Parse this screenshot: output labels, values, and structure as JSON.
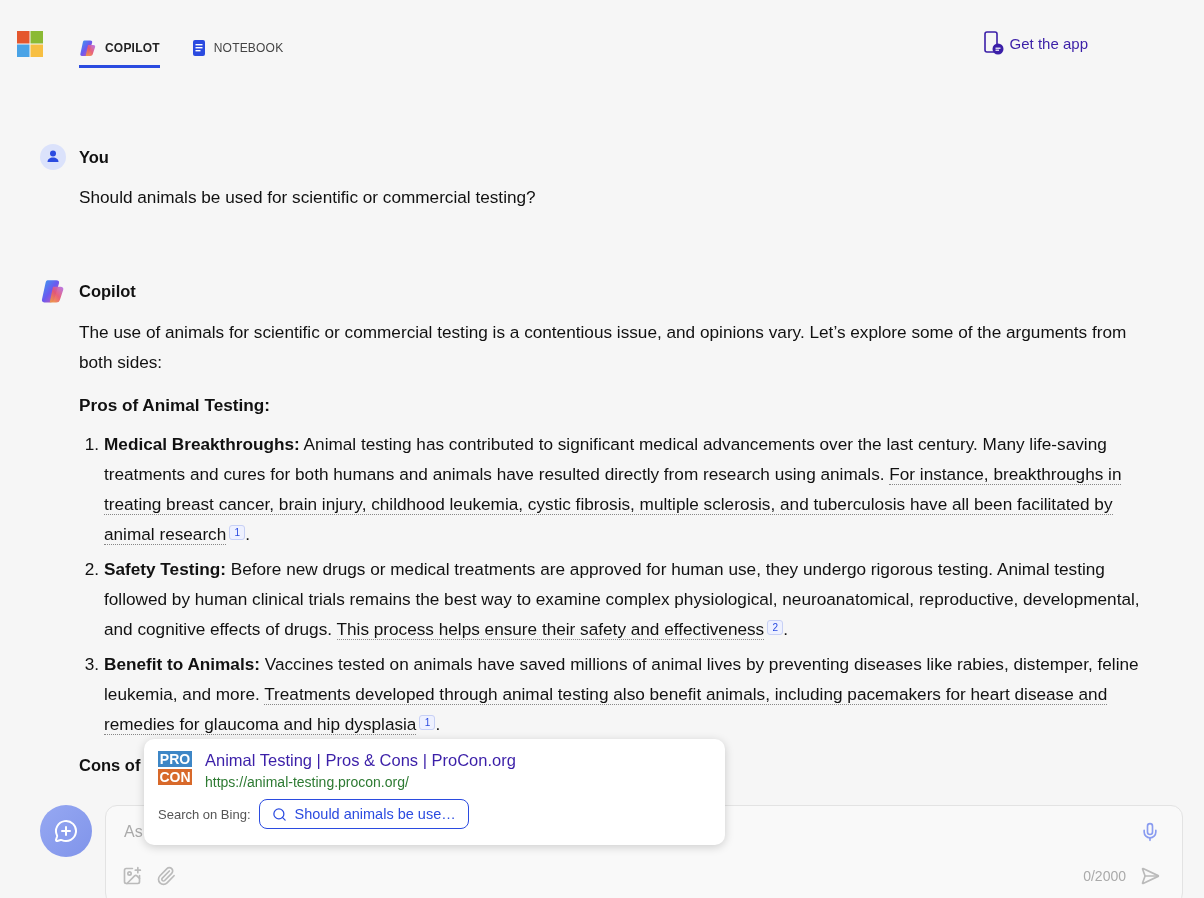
{
  "header": {
    "tabs": [
      {
        "label": "COPILOT",
        "selected": true
      },
      {
        "label": "NOTEBOOK",
        "selected": false
      }
    ],
    "get_app": "Get the app"
  },
  "conversation": [
    {
      "kind": "user",
      "author": "You",
      "text": "Should animals be used for scientific or commercial testing?"
    },
    {
      "kind": "assistant",
      "author": "Copilot",
      "intro": "The use of animals for scientific or commercial testing is a contentious issue, and opinions vary. Let’s explore some of the arguments from both sides:",
      "section_heading": "Pros of Animal Testing:",
      "items": [
        {
          "number": "1.",
          "text": "**Medical Breakthroughs:** Animal testing has contributed to significant medical advancements over the last century. Many life-saving treatments and cures for both humans and animals have resulted directly from research using animals.",
          "cited_text": "For instance, breakthroughs in treating breast cancer, brain injury, childhood leukemia, cystic fibrosis, multiple sclerosis, and tuberculosis have all been facilitated by animal research",
          "citation": "1",
          "after": "."
        },
        {
          "number": "2.",
          "text": "**Safety Testing:** Before new drugs or medical treatments are approved for human use, they undergo rigorous testing. Animal testing followed by human clinical trials remains the best way to examine complex physiological, neuroanatomical, reproductive, developmental, and cognitive effects of drugs.",
          "cited_text": "This process helps ensure their safety and effectiveness",
          "citation": "2",
          "after": "."
        },
        {
          "number": "3.",
          "text": "**Benefit to Animals:** Vaccines tested on animals have saved millions of animal lives by preventing diseases like rabies, distemper, feline leukemia, and more.",
          "cited_text": "Treatments developed through animal testing also benefit animals, including pacemakers for heart disease and remedies for glaucoma and hip dysplasia",
          "citation": "1",
          "after": "."
        }
      ],
      "next_heading": "Cons of"
    }
  ],
  "source_popup": {
    "logo_top": "PRO",
    "logo_bottom": "CON",
    "title": "Animal Testing | Pros & Cons | ProCon.org",
    "url": "https://animal-testing.procon.org/",
    "search_label": "Search on Bing:",
    "search_query": "Should animals be use…"
  },
  "composer": {
    "placeholder": "As",
    "counter": "0/2000"
  }
}
